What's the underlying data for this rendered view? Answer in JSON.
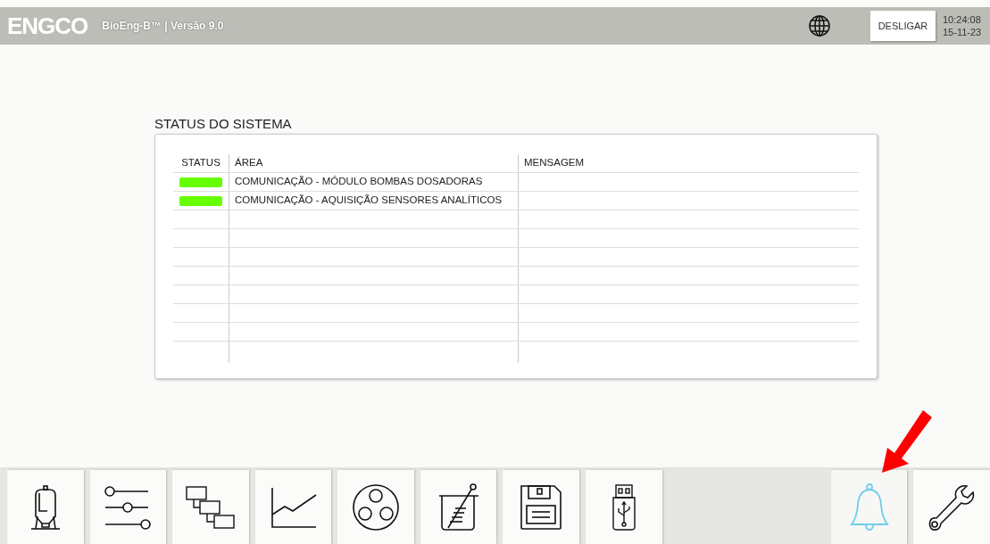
{
  "header": {
    "logo": "ENGCO",
    "version": "BioEng-B™ | Versão 9.0",
    "power_button": "DESLIGAR",
    "time": "10:24:08",
    "date": "15-11-23"
  },
  "status_panel": {
    "title": "STATUS DO SISTEMA",
    "columns": [
      "STATUS",
      "ÁREA",
      "MENSAGEM"
    ],
    "rows": [
      {
        "color": "#66ff00",
        "area": "COMUNICAÇÃO - MÓDULO BOMBAS DOSADORAS"
      },
      {
        "color": "#66ff00",
        "area": "COMUNICAÇÃO - AQUISIÇÃO SENSORES ANALÍTICOS"
      }
    ]
  },
  "toolbar": [
    {
      "kind": "tank",
      "selected": false
    },
    {
      "kind": "sliders",
      "selected": false
    },
    {
      "kind": "blocks",
      "selected": false
    },
    {
      "kind": "chart",
      "selected": false
    },
    {
      "kind": "rotor",
      "selected": false
    },
    {
      "kind": "beaker",
      "selected": false
    },
    {
      "kind": "save",
      "selected": false
    },
    {
      "kind": "usb",
      "selected": false
    },
    {
      "kind": "spacer",
      "selected": false
    },
    {
      "kind": "bell",
      "selected": true
    },
    {
      "kind": "wrench",
      "selected": false
    }
  ]
}
